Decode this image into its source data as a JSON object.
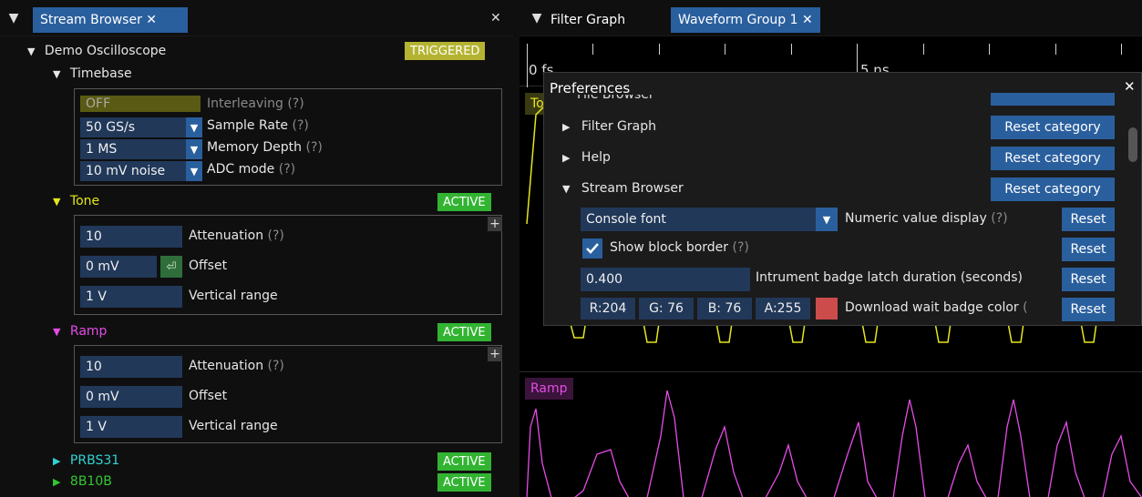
{
  "left_panel": {
    "tab_title": "Stream Browser ✕",
    "close_glyph": "✕",
    "device": {
      "name": "Demo Oscilloscope",
      "status": "TRIGGERED"
    },
    "timebase": {
      "label": "Timebase",
      "interleave_value": "OFF",
      "interleave_label": "Interleaving",
      "sample_rate_value": "50 GS/s",
      "sample_rate_label": "Sample Rate",
      "memory_depth_value": "1 MS",
      "memory_depth_label": "Memory Depth",
      "adc_mode_value": "10 mV noise",
      "adc_mode_label": "ADC mode",
      "help": "(?)"
    },
    "channels": [
      {
        "name": "Tone",
        "status": "ACTIVE",
        "color": "#e6e61e",
        "attenuation_value": "10",
        "attenuation_label": "Attenuation",
        "offset_value": "0 mV",
        "offset_label": "Offset",
        "range_value": "1 V",
        "range_label": "Vertical range"
      },
      {
        "name": "Ramp",
        "status": "ACTIVE",
        "color": "#e64ce6",
        "attenuation_value": "10",
        "attenuation_label": "Attenuation",
        "offset_value": "0 mV",
        "offset_label": "Offset",
        "range_value": "1 V",
        "range_label": "Vertical range"
      },
      {
        "name": "PRBS31",
        "status": "ACTIVE",
        "color": "#32d2d2"
      },
      {
        "name": "8B10B",
        "status": "ACTIVE",
        "color": "#32c832"
      }
    ]
  },
  "right_panel": {
    "tabs": [
      "Filter Graph",
      "Waveform Group 1 ✕"
    ],
    "ruler_labels": [
      "0 fs",
      "5 ns"
    ],
    "tone_label": "Tone",
    "ramp_label": "Ramp"
  },
  "preferences": {
    "title": "Preferences",
    "close_glyph": "✕",
    "partial_category": "File Browser",
    "categories": [
      "Filter Graph",
      "Help",
      "Stream Browser"
    ],
    "reset_category_label": "Reset category",
    "reset_label": "Reset",
    "numeric_display": {
      "value": "Console font",
      "label": "Numeric value display",
      "help": "(?)"
    },
    "block_border": {
      "label": "Show block border",
      "help": "(?)"
    },
    "latch_duration": {
      "value": "0.400",
      "label": "Intrument badge latch duration (seconds)"
    },
    "badge_color": {
      "r": "R:204",
      "g": "G: 76",
      "b": "B: 76",
      "a": "A:255",
      "label": "Download wait badge color",
      "help": "(",
      "swatch": "#cc4c4c"
    }
  }
}
